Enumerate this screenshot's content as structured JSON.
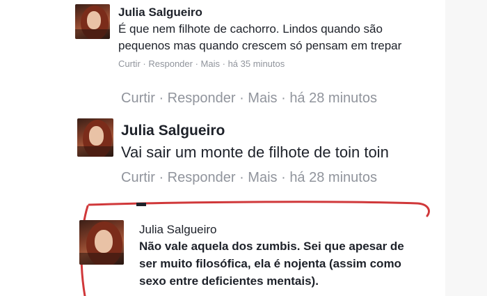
{
  "comments": [
    {
      "author": "Julia Salgueiro",
      "lines": [
        "É que nem filhote de cachorro. Lindos quando são",
        "pequenos mas quando crescem só pensam em trepar"
      ],
      "actions": {
        "like": "Curtir",
        "reply": "Responder",
        "more": "Mais",
        "sep": "·",
        "time": "há 35 minutos"
      }
    },
    {
      "actions": {
        "like": "Curtir",
        "reply": "Responder",
        "more": "Mais",
        "sep": "·",
        "time": "há 28 minutos"
      }
    },
    {
      "author": "Julia Salgueiro",
      "lines": [
        "Vai sair um monte de filhote de toin toin"
      ],
      "actions": {
        "like": "Curtir",
        "reply": "Responder",
        "more": "Mais",
        "sep": "·",
        "time": "há 28 minutos"
      }
    },
    {
      "author": "Julia Salgueiro",
      "lines": [
        "Não vale aquela dos zumbis. Sei que apesar de",
        "ser muito filosófica, ela é nojenta (assim como",
        "sexo entre deficientes mentais)."
      ]
    }
  ],
  "colors": {
    "text": "#1d2129",
    "meta": "#90949c",
    "highlight": "#d0383a"
  }
}
